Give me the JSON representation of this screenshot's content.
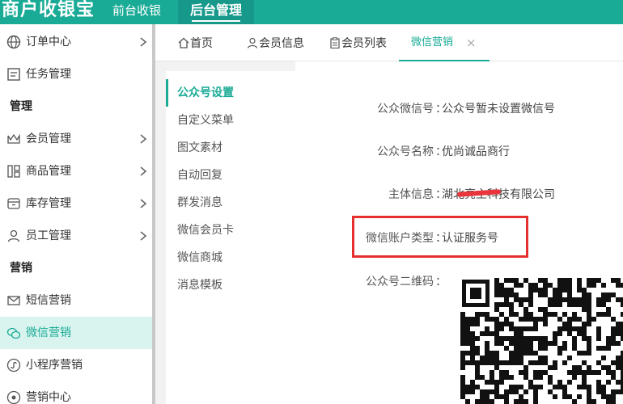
{
  "app": {
    "logo": "商户收银宝",
    "topnav": [
      "前台收银",
      "后台管理"
    ],
    "active_topnav": "后台管理"
  },
  "sidebar": {
    "items": [
      {
        "label": "订单中心",
        "icon": "globe-icon",
        "has_children": true
      },
      {
        "label": "任务管理",
        "icon": "task-list-icon",
        "has_children": false
      },
      {
        "heading": "管理"
      },
      {
        "label": "会员管理",
        "icon": "crown-icon",
        "has_children": true
      },
      {
        "label": "商品管理",
        "icon": "grid-icon",
        "has_children": true
      },
      {
        "label": "库存管理",
        "icon": "inventory-box-icon",
        "has_children": true
      },
      {
        "label": "员工管理",
        "icon": "user-icon",
        "has_children": true
      },
      {
        "heading": "营销"
      },
      {
        "label": "短信营销",
        "icon": "envelope-icon",
        "has_children": false
      },
      {
        "label": "微信营销",
        "icon": "wechat-icon",
        "has_children": false,
        "active": true
      },
      {
        "label": "小程序营销",
        "icon": "mini-program-icon",
        "has_children": false
      },
      {
        "label": "营销中心",
        "icon": "marketing-icon",
        "has_children": false
      }
    ]
  },
  "tabs": [
    {
      "label": "首页",
      "icon": "home-icon"
    },
    {
      "label": "会员信息",
      "icon": "user-icon"
    },
    {
      "label": "会员列表",
      "icon": "clipboard-icon"
    },
    {
      "label": "微信营销",
      "icon": "",
      "active": true,
      "close": "×"
    }
  ],
  "submenu": {
    "items": [
      "公众号设置",
      "自定义菜单",
      "图文素材",
      "自动回复",
      "群发消息",
      "微信会员卡",
      "微信商城",
      "消息模板"
    ],
    "active": "公众号设置"
  },
  "details": [
    {
      "label": "公众微信号",
      "value": "公众号暂未设置微信号"
    },
    {
      "label": "公众号名称",
      "value": "优尚诚品商行"
    },
    {
      "label": "主体信息",
      "value": "湖北亮主科技有限公司"
    },
    {
      "label": "微信账户类型",
      "value": "认证服务号"
    },
    {
      "label": "公众号二维码",
      "value": ""
    }
  ],
  "separator": "：",
  "colors": {
    "brand": "#1aab96",
    "active_bg": "#d9f4ef",
    "highlight": "#e5302e"
  }
}
